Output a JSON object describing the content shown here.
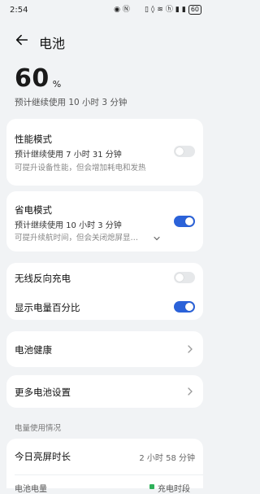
{
  "status_bar": {
    "time": "2:54",
    "battery": "60",
    "icons": [
      "eye-icon",
      "nfc-icon",
      "vibrate-icon",
      "mute-icon",
      "wifi-icon",
      "hd-icon",
      "signal-icon",
      "signal-icon",
      "battery-icon"
    ]
  },
  "header": {
    "title": "电池"
  },
  "hero": {
    "percent": "60",
    "unit": "%",
    "remaining": "预计继续使用 10 小时 3 分钟"
  },
  "performance_mode": {
    "title": "性能模式",
    "sub": "预计继续使用 7 小时 31 分钟",
    "desc": "可提升设备性能，但会增加耗电和发热",
    "enabled": false
  },
  "power_saving": {
    "title": "省电模式",
    "sub": "预计继续使用 10 小时 3 分钟",
    "desc": "可提升续航时间，但会关闭熄屏显…",
    "enabled": true
  },
  "wireless_reverse": {
    "title": "无线反向充电",
    "enabled": false
  },
  "show_percentage": {
    "title": "显示电量百分比",
    "enabled": true
  },
  "battery_health": {
    "title": "电池健康"
  },
  "more_settings": {
    "title": "更多电池设置"
  },
  "usage": {
    "section_label": "电量使用情况",
    "screen_on_title": "今日亮屏时长",
    "screen_on_value": "2 小时 58 分钟",
    "battery_level_label": "电池电量",
    "charging_label": "充电时段"
  },
  "colors": {
    "accent": "#2b62d9",
    "background": "#f1f3f5",
    "card": "#ffffff",
    "toggle_off": "#e6e8ea",
    "charging_green": "#2fb05a"
  }
}
